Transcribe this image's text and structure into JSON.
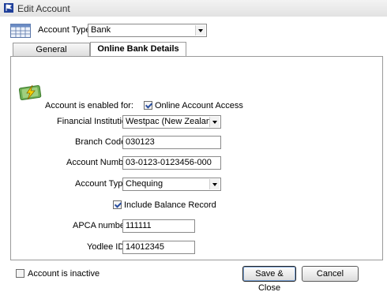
{
  "window": {
    "title": "Edit Account"
  },
  "header": {
    "account_type_label": "Account Type",
    "account_type_value": "Bank"
  },
  "tabs": [
    {
      "label": "General",
      "active": false
    },
    {
      "label": "Online Bank Details",
      "active": true
    }
  ],
  "form": {
    "enabled_label": "Account is enabled for:",
    "online_access_label": "Online Account Access",
    "online_access_checked": true,
    "institution_label": "Financial Institution:",
    "institution_value": "Westpac (New Zealand)",
    "branch_label": "Branch Code:",
    "branch_value": "030123",
    "account_number_label": "Account Number:",
    "account_number_value": "03-0123-0123456-000",
    "account_type_label": "Account Type:",
    "account_type_value": "Chequing",
    "balance_label": "Include Balance Record",
    "balance_checked": true,
    "apca_label": "APCA number:",
    "apca_value": "111111",
    "yodlee_label": "Yodlee ID:",
    "yodlee_value": "14012345"
  },
  "footer": {
    "inactive_label": "Account is inactive",
    "inactive_checked": false,
    "save_label": "Save & Close",
    "cancel_label": "Cancel"
  },
  "icons": {
    "title": "app-flag-icon",
    "account_type": "ledger-grid-icon",
    "online": "money-lightning-icon"
  },
  "colors": {
    "accent": "#2a4fa0",
    "title_icon": "#1f3f9a"
  }
}
